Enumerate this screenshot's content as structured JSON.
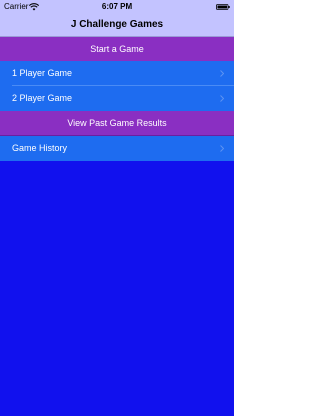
{
  "status_bar": {
    "carrier": "Carrier",
    "time": "6:07 PM",
    "wifi_icon": "wifi-icon",
    "battery_icon": "battery-icon"
  },
  "nav": {
    "title": "J Challenge Games"
  },
  "sections": [
    {
      "header": "Start a Game",
      "rows": [
        {
          "label": "1 Player Game",
          "accessory": "chevron-right-icon"
        },
        {
          "label": "2 Player Game",
          "accessory": "chevron-right-icon"
        }
      ]
    },
    {
      "header": "View Past Game Results",
      "rows": [
        {
          "label": "Game History",
          "accessory": "chevron-right-icon"
        }
      ]
    }
  ],
  "colors": {
    "background": "#1111ee",
    "nav_bar": "#c3c3ff",
    "section_header": "#8a2fc2",
    "row": "#1e6cf0"
  }
}
